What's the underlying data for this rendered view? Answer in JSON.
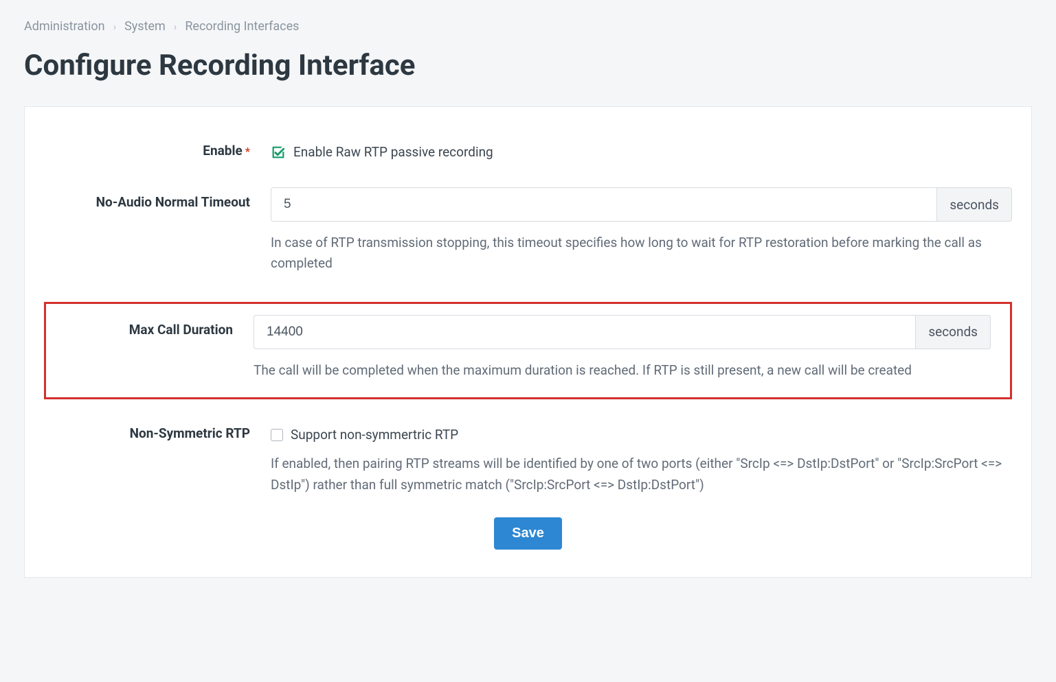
{
  "breadcrumb": {
    "item1": "Administration",
    "item2": "System",
    "item3": "Recording Interfaces"
  },
  "page_title": "Configure Recording Interface",
  "fields": {
    "enable": {
      "label": "Enable",
      "required_marker": "*",
      "checkbox_label": "Enable Raw RTP passive recording",
      "checked": true
    },
    "no_audio_timeout": {
      "label": "No-Audio Normal Timeout",
      "value": "5",
      "unit": "seconds",
      "help": "In case of RTP transmission stopping, this timeout specifies how long to wait for RTP restoration before marking the call as completed"
    },
    "max_call_duration": {
      "label": "Max Call Duration",
      "value": "14400",
      "unit": "seconds",
      "help": "The call will be completed when the maximum duration is reached. If RTP is still present, a new call will be created"
    },
    "non_symmetric_rtp": {
      "label": "Non-Symmetric RTP",
      "checkbox_label": "Support non-symmertric RTP",
      "checked": false,
      "help": "If enabled, then pairing RTP streams will be identified by one of two ports (either \"SrcIp <=> DstIp:DstPort\" or \"SrcIp:SrcPort <=> DstIp\") rather than full symmetric match (\"SrcIp:SrcPort <=> DstIp:DstPort\")"
    }
  },
  "buttons": {
    "save": "Save"
  }
}
